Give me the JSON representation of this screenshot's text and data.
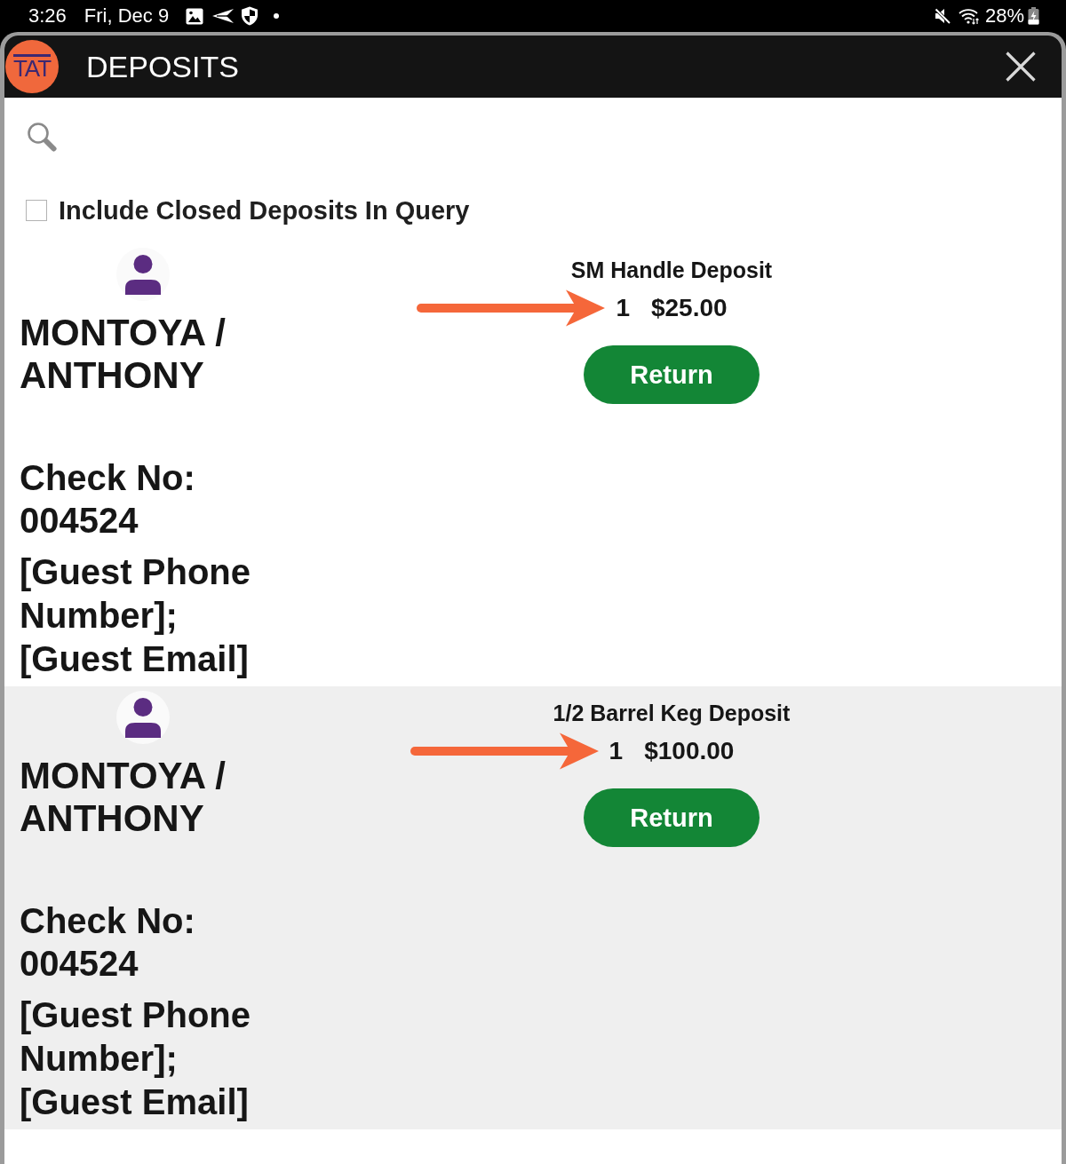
{
  "status_bar": {
    "time": "3:26",
    "date": "Fri, Dec 9",
    "battery": "28%"
  },
  "window": {
    "logo": "TAT",
    "title": "DEPOSITS"
  },
  "include_closed": {
    "label": "Include Closed Deposits In Query",
    "checked": false
  },
  "deposits": [
    {
      "guest": "MONTOYA / ANTHONY",
      "check_no": "Check No: 004524",
      "contact": "[Guest Phone Number]; [Guest Email]",
      "item": "SM Handle Deposit",
      "quantity": "1",
      "amount": "$25.00",
      "action": "Return",
      "arrow": true
    },
    {
      "guest": "MONTOYA / ANTHONY",
      "check_no": "Check No: 004524",
      "contact": "[Guest Phone Number]; [Guest Email]",
      "item": "1/2 Barrel Keg Deposit",
      "quantity": "1",
      "amount": "$100.00",
      "action": "Return",
      "arrow": true
    }
  ]
}
